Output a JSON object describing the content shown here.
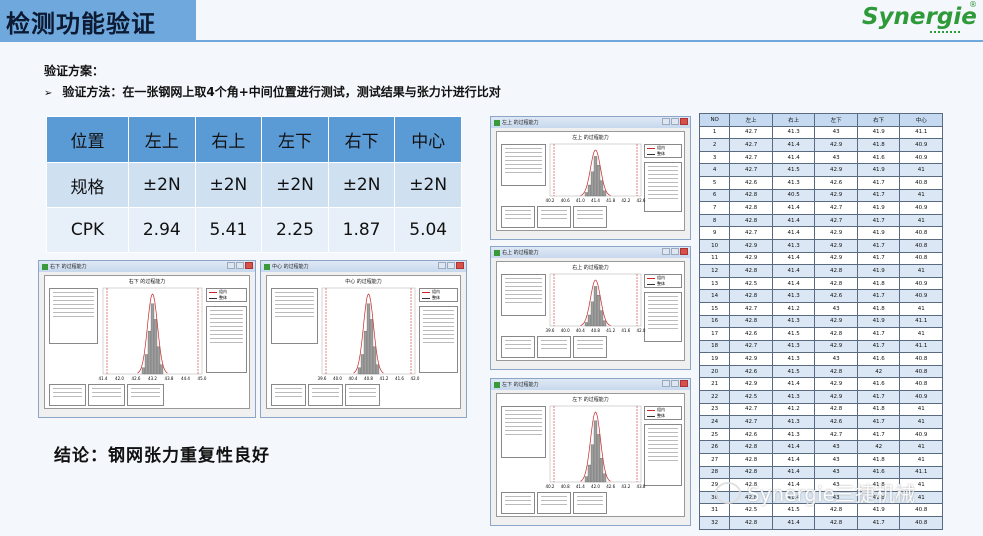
{
  "header": {
    "title": "检测功能验证",
    "logo": "Synergie",
    "logo_mark": "®"
  },
  "plan": {
    "title": "验证方案：",
    "arrow": "➢",
    "method": "验证方法：在一张钢网上取4个角+中间位置进行测试，测试结果与张力计进行比对"
  },
  "spec_table": {
    "header": [
      "位置",
      "左上",
      "右上",
      "左下",
      "右下",
      "中心"
    ],
    "rows": [
      [
        "规格",
        "±2N",
        "±2N",
        "±2N",
        "±2N",
        "±2N"
      ],
      [
        "CPK",
        "2.94",
        "5.41",
        "2.25",
        "1.87",
        "5.04"
      ]
    ]
  },
  "conclusion": "结论：钢网张力重复性良好",
  "windows": [
    {
      "key": "w1",
      "app_title": "右下 的过程能力",
      "plot_title": "右下 的过程能力",
      "ticks": [
        "41.4",
        "42.0",
        "42.6",
        "43.2",
        "43.8",
        "44.4",
        "45.0"
      ],
      "legend": [
        "组内",
        "整体"
      ]
    },
    {
      "key": "w2",
      "app_title": "中心 的过程能力",
      "plot_title": "中心 的过程能力",
      "ticks": [
        "39.6",
        "40.0",
        "40.4",
        "40.8",
        "41.2",
        "41.6",
        "42.0"
      ],
      "legend": [
        "组内",
        "整体"
      ]
    },
    {
      "key": "w3",
      "app_title": "左上 的过程能力",
      "plot_title": "左上 的过程能力",
      "ticks": [
        "40.2",
        "40.6",
        "41.0",
        "41.4",
        "41.8",
        "42.2",
        "42.6"
      ],
      "legend": [
        "组内",
        "整体"
      ]
    },
    {
      "key": "w4",
      "app_title": "右上 的过程能力",
      "plot_title": "右上 的过程能力",
      "ticks": [
        "39.6",
        "40.0",
        "40.4",
        "40.8",
        "41.2",
        "41.6",
        "42.0"
      ],
      "legend": [
        "组内",
        "整体"
      ]
    },
    {
      "key": "w5",
      "app_title": "左下 的过程能力",
      "plot_title": "左下 的过程能力",
      "ticks": [
        "40.2",
        "40.8",
        "41.4",
        "42.0",
        "42.6",
        "43.2",
        "43.8"
      ],
      "legend": [
        "组内",
        "整体"
      ]
    }
  ],
  "data_table": {
    "header": [
      "NO",
      "左上",
      "右上",
      "左下",
      "右下",
      "中心"
    ],
    "rows": [
      [
        "1",
        "42.7",
        "41.3",
        "43",
        "41.9",
        "41.1"
      ],
      [
        "2",
        "42.7",
        "41.4",
        "42.9",
        "41.8",
        "40.9"
      ],
      [
        "3",
        "42.7",
        "41.4",
        "43",
        "41.6",
        "40.9"
      ],
      [
        "4",
        "42.7",
        "41.5",
        "42.9",
        "41.9",
        "41"
      ],
      [
        "5",
        "42.6",
        "41.3",
        "42.6",
        "41.7",
        "40.8"
      ],
      [
        "6",
        "42.8",
        "40.5",
        "42.9",
        "41.7",
        "41"
      ],
      [
        "7",
        "42.8",
        "41.4",
        "42.7",
        "41.9",
        "40.9"
      ],
      [
        "8",
        "42.8",
        "41.4",
        "42.7",
        "41.7",
        "41"
      ],
      [
        "9",
        "42.7",
        "41.4",
        "42.9",
        "41.9",
        "40.8"
      ],
      [
        "10",
        "42.9",
        "41.3",
        "42.9",
        "41.7",
        "40.8"
      ],
      [
        "11",
        "42.9",
        "41.4",
        "42.9",
        "41.7",
        "40.8"
      ],
      [
        "12",
        "42.8",
        "41.4",
        "42.8",
        "41.9",
        "41"
      ],
      [
        "13",
        "42.5",
        "41.4",
        "42.8",
        "41.8",
        "40.9"
      ],
      [
        "14",
        "42.8",
        "41.3",
        "42.6",
        "41.7",
        "40.9"
      ],
      [
        "15",
        "42.7",
        "41.2",
        "43",
        "41.8",
        "41"
      ],
      [
        "16",
        "42.8",
        "41.3",
        "42.9",
        "41.9",
        "41.1"
      ],
      [
        "17",
        "42.6",
        "41.5",
        "42.8",
        "41.7",
        "41"
      ],
      [
        "18",
        "42.7",
        "41.3",
        "42.9",
        "41.7",
        "41.1"
      ],
      [
        "19",
        "42.9",
        "41.3",
        "43",
        "41.6",
        "40.8"
      ],
      [
        "20",
        "42.6",
        "41.5",
        "42.8",
        "42",
        "40.8"
      ],
      [
        "21",
        "42.9",
        "41.4",
        "42.9",
        "41.6",
        "40.8"
      ],
      [
        "22",
        "42.5",
        "41.3",
        "42.9",
        "41.7",
        "40.9"
      ],
      [
        "23",
        "42.7",
        "41.2",
        "42.8",
        "41.8",
        "41"
      ],
      [
        "24",
        "42.7",
        "41.3",
        "42.6",
        "41.7",
        "41"
      ],
      [
        "25",
        "42.6",
        "41.3",
        "42.7",
        "41.7",
        "40.9"
      ],
      [
        "26",
        "42.8",
        "41.4",
        "43",
        "42",
        "41"
      ],
      [
        "27",
        "42.8",
        "41.4",
        "43",
        "41.8",
        "41"
      ],
      [
        "28",
        "42.8",
        "41.4",
        "43",
        "41.6",
        "41.1"
      ],
      [
        "29",
        "42.8",
        "41.4",
        "43",
        "41.8",
        "41"
      ],
      [
        "30",
        "42.8",
        "41.4",
        "43",
        "41.8",
        "41"
      ],
      [
        "31",
        "42.5",
        "41.5",
        "42.8",
        "41.9",
        "40.8"
      ],
      [
        "32",
        "42.8",
        "41.4",
        "42.8",
        "41.7",
        "40.8"
      ]
    ]
  },
  "watermark": "Synergie三捷机械",
  "colors": {
    "accent": "#5b9bd5",
    "logo_green": "#2e9a3a",
    "spec_line": "#d32f2f",
    "fit_curve": "#c62828"
  }
}
